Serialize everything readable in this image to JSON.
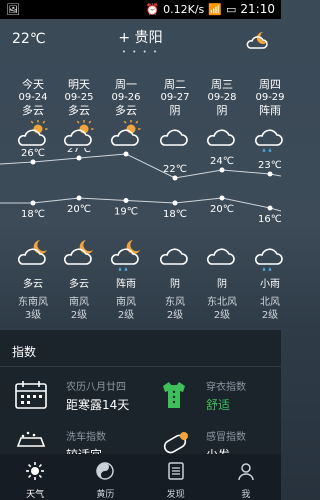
{
  "status": {
    "left_icons": "🖼",
    "network_speed": "0.12K/s",
    "time": "21:10"
  },
  "header": {
    "current_temp": "22℃",
    "add_icon": "+",
    "city": "贵阳",
    "page_dots": "• • • •",
    "weather_icon": "cloud-moon-icon"
  },
  "forecast": [
    {
      "day": "今天",
      "date": "09-24",
      "day_cond": "多云",
      "day_icon": "partly-sunny-icon",
      "high": "26℃",
      "low": "18℃",
      "night_icon": "cloud-moon-icon",
      "night_cond": "多云",
      "wind_dir": "东南风",
      "wind_level": "3级"
    },
    {
      "day": "明天",
      "date": "09-25",
      "day_cond": "多云",
      "day_icon": "partly-sunny-icon",
      "high": "27℃",
      "low": "20℃",
      "night_icon": "cloud-moon-icon",
      "night_cond": "多云",
      "wind_dir": "南风",
      "wind_level": "2级"
    },
    {
      "day": "周一",
      "date": "09-26",
      "day_cond": "多云",
      "day_icon": "partly-sunny-icon",
      "high": "28℃",
      "low": "19℃",
      "night_icon": "rain-moon-icon",
      "night_cond": "阵雨",
      "wind_dir": "南风",
      "wind_level": "2级"
    },
    {
      "day": "周二",
      "date": "09-27",
      "day_cond": "阴",
      "day_icon": "cloud-icon",
      "high": "22℃",
      "low": "18℃",
      "night_icon": "cloud-icon",
      "night_cond": "阴",
      "wind_dir": "东风",
      "wind_level": "2级"
    },
    {
      "day": "周三",
      "date": "09-28",
      "day_cond": "阴",
      "day_icon": "cloud-icon",
      "high": "24℃",
      "low": "20℃",
      "night_icon": "cloud-icon",
      "night_cond": "阴",
      "wind_dir": "东北风",
      "wind_level": "2级"
    },
    {
      "day": "周四",
      "date": "09-29",
      "day_cond": "阵雨",
      "day_icon": "rain-icon",
      "high": "23℃",
      "low": "16℃",
      "night_icon": "rain-icon",
      "night_cond": "小雨",
      "wind_dir": "北风",
      "wind_level": "2级"
    }
  ],
  "index": {
    "title": "指数",
    "items": [
      {
        "label": "农历八月廿四",
        "value": "距寒露14天",
        "icon": "calendar-icon"
      },
      {
        "label": "穿衣指数",
        "value": "舒适",
        "icon": "shirt-icon"
      },
      {
        "label": "洗车指数",
        "value": "较适宜",
        "icon": "car-icon"
      },
      {
        "label": "感冒指数",
        "value": "少发",
        "icon": "pill-icon"
      }
    ]
  },
  "tabs": [
    {
      "label": "天气",
      "icon": "sun-icon",
      "active": true
    },
    {
      "label": "黄历",
      "icon": "yin-yang-icon",
      "active": false
    },
    {
      "label": "发现",
      "icon": "discover-icon",
      "active": false
    },
    {
      "label": "我",
      "icon": "person-icon",
      "active": false
    }
  ],
  "colors": {
    "accent_green": "#3fbf5c",
    "rain_blue": "#4aa3df",
    "sun_orange": "#f3a43b"
  }
}
